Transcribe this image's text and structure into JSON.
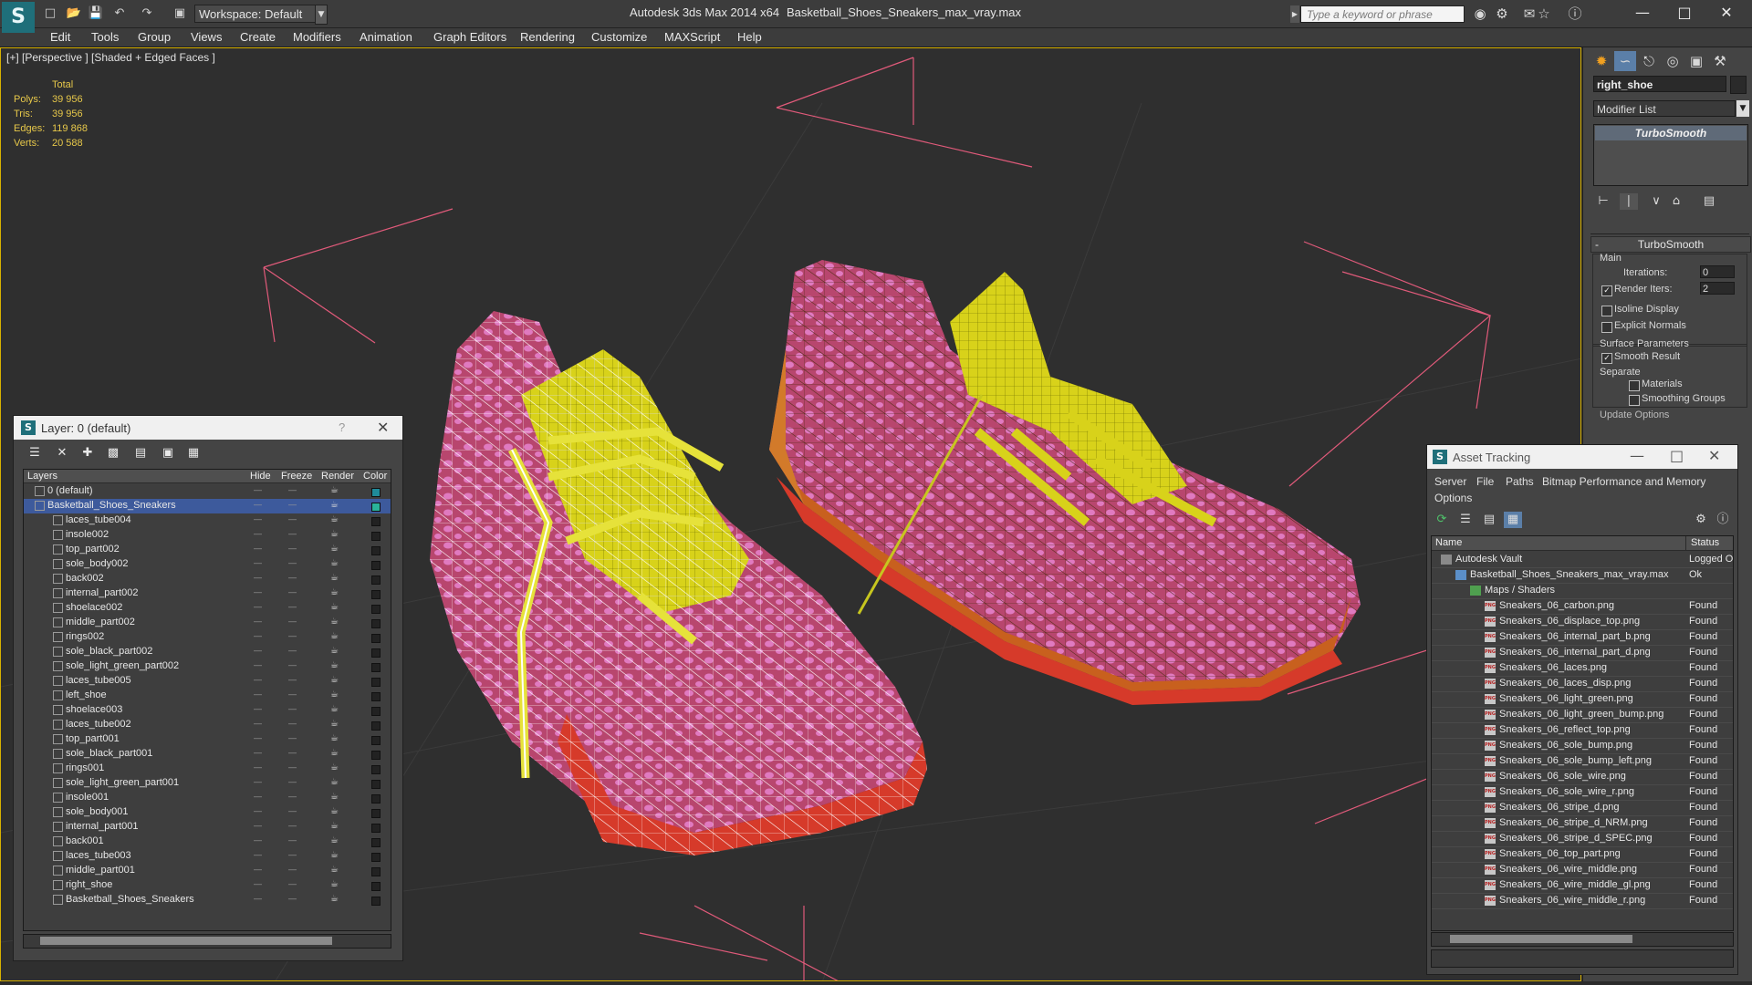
{
  "titlebar": {
    "workspace": "Workspace: Default",
    "app_title": "Autodesk 3ds Max  2014 x64",
    "file_title": "Basketball_Shoes_Sneakers_max_vray.max",
    "search_placeholder": "Type a keyword or phrase"
  },
  "menu": [
    "Edit",
    "Tools",
    "Group",
    "Views",
    "Create",
    "Modifiers",
    "Animation",
    "Graph Editors",
    "Rendering",
    "Customize",
    "MAXScript",
    "Help"
  ],
  "viewport": {
    "label": "[+] [Perspective ] [Shaded + Edged Faces ]",
    "stats": {
      "total_label": "Total",
      "rows": [
        {
          "k": "Polys:",
          "v": "39 956"
        },
        {
          "k": "Tris:",
          "v": "39 956"
        },
        {
          "k": "Edges:",
          "v": "119 868"
        },
        {
          "k": "Verts:",
          "v": "20 588"
        }
      ]
    }
  },
  "command_panel": {
    "object_name": "right_shoe",
    "modifier_list": "Modifier List",
    "stack_item": "TurboSmooth",
    "rollout_title": "TurboSmooth",
    "main_label": "Main",
    "iterations_label": "Iterations:",
    "iterations_value": "0",
    "render_iters_label": "Render Iters:",
    "render_iters_value": "2",
    "isoline": "Isoline Display",
    "explicit": "Explicit Normals",
    "surface_params": "Surface Parameters",
    "smooth_result": "Smooth Result",
    "separate": "Separate",
    "materials": "Materials",
    "smoothing_groups": "Smoothing Groups",
    "update_options": "Update Options"
  },
  "layer_panel": {
    "title": "Layer: 0 (default)",
    "help": "?",
    "headers": {
      "layers": "Layers",
      "hide": "Hide",
      "freeze": "Freeze",
      "render": "Render",
      "color": "Color"
    },
    "rows": [
      {
        "name": "0 (default)",
        "indent": 1,
        "color": "#1f8a9a",
        "selected": false
      },
      {
        "name": "Basketball_Shoes_Sneakers",
        "indent": 1,
        "color": "#2ab39a",
        "selected": true
      },
      {
        "name": "laces_tube004",
        "indent": 2
      },
      {
        "name": "insole002",
        "indent": 2
      },
      {
        "name": "top_part002",
        "indent": 2
      },
      {
        "name": "sole_body002",
        "indent": 2
      },
      {
        "name": "back002",
        "indent": 2
      },
      {
        "name": "internal_part002",
        "indent": 2
      },
      {
        "name": "shoelace002",
        "indent": 2
      },
      {
        "name": "middle_part002",
        "indent": 2
      },
      {
        "name": "rings002",
        "indent": 2
      },
      {
        "name": "sole_black_part002",
        "indent": 2
      },
      {
        "name": "sole_light_green_part002",
        "indent": 2
      },
      {
        "name": "laces_tube005",
        "indent": 2
      },
      {
        "name": "left_shoe",
        "indent": 2
      },
      {
        "name": "shoelace003",
        "indent": 2
      },
      {
        "name": "laces_tube002",
        "indent": 2
      },
      {
        "name": "top_part001",
        "indent": 2
      },
      {
        "name": "sole_black_part001",
        "indent": 2
      },
      {
        "name": "rings001",
        "indent": 2
      },
      {
        "name": "sole_light_green_part001",
        "indent": 2
      },
      {
        "name": "insole001",
        "indent": 2
      },
      {
        "name": "sole_body001",
        "indent": 2
      },
      {
        "name": "internal_part001",
        "indent": 2
      },
      {
        "name": "back001",
        "indent": 2
      },
      {
        "name": "laces_tube003",
        "indent": 2
      },
      {
        "name": "middle_part001",
        "indent": 2
      },
      {
        "name": "right_shoe",
        "indent": 2
      },
      {
        "name": "Basketball_Shoes_Sneakers",
        "indent": 2
      }
    ]
  },
  "asset_panel": {
    "title": "Asset Tracking",
    "menu": [
      "Server",
      "File",
      "Paths",
      "Bitmap Performance and Memory",
      "Options"
    ],
    "headers": {
      "name": "Name",
      "status": "Status"
    },
    "rows": [
      {
        "name": "Autodesk Vault",
        "status": "Logged O",
        "indent": 0,
        "icon": "vault"
      },
      {
        "name": "Basketball_Shoes_Sneakers_max_vray.max",
        "status": "Ok",
        "indent": 1,
        "icon": "file"
      },
      {
        "name": "Maps / Shaders",
        "status": "",
        "indent": 2,
        "icon": "folder"
      },
      {
        "name": "Sneakers_06_carbon.png",
        "status": "Found",
        "indent": 3,
        "icon": "png"
      },
      {
        "name": "Sneakers_06_displace_top.png",
        "status": "Found",
        "indent": 3,
        "icon": "png"
      },
      {
        "name": "Sneakers_06_internal_part_b.png",
        "status": "Found",
        "indent": 3,
        "icon": "png"
      },
      {
        "name": "Sneakers_06_internal_part_d.png",
        "status": "Found",
        "indent": 3,
        "icon": "png"
      },
      {
        "name": "Sneakers_06_laces.png",
        "status": "Found",
        "indent": 3,
        "icon": "png"
      },
      {
        "name": "Sneakers_06_laces_disp.png",
        "status": "Found",
        "indent": 3,
        "icon": "png"
      },
      {
        "name": "Sneakers_06_light_green.png",
        "status": "Found",
        "indent": 3,
        "icon": "png"
      },
      {
        "name": "Sneakers_06_light_green_bump.png",
        "status": "Found",
        "indent": 3,
        "icon": "png"
      },
      {
        "name": "Sneakers_06_reflect_top.png",
        "status": "Found",
        "indent": 3,
        "icon": "png"
      },
      {
        "name": "Sneakers_06_sole_bump.png",
        "status": "Found",
        "indent": 3,
        "icon": "png"
      },
      {
        "name": "Sneakers_06_sole_bump_left.png",
        "status": "Found",
        "indent": 3,
        "icon": "png"
      },
      {
        "name": "Sneakers_06_sole_wire.png",
        "status": "Found",
        "indent": 3,
        "icon": "png"
      },
      {
        "name": "Sneakers_06_sole_wire_r.png",
        "status": "Found",
        "indent": 3,
        "icon": "png"
      },
      {
        "name": "Sneakers_06_stripe_d.png",
        "status": "Found",
        "indent": 3,
        "icon": "png"
      },
      {
        "name": "Sneakers_06_stripe_d_NRM.png",
        "status": "Found",
        "indent": 3,
        "icon": "png"
      },
      {
        "name": "Sneakers_06_stripe_d_SPEC.png",
        "status": "Found",
        "indent": 3,
        "icon": "png"
      },
      {
        "name": "Sneakers_06_top_part.png",
        "status": "Found",
        "indent": 3,
        "icon": "png"
      },
      {
        "name": "Sneakers_06_wire_middle.png",
        "status": "Found",
        "indent": 3,
        "icon": "png"
      },
      {
        "name": "Sneakers_06_wire_middle_gl.png",
        "status": "Found",
        "indent": 3,
        "icon": "png"
      },
      {
        "name": "Sneakers_06_wire_middle_r.png",
        "status": "Found",
        "indent": 3,
        "icon": "png"
      }
    ]
  },
  "colors": {
    "accent": "#d8b100",
    "selection": "#3d5a9c",
    "shoe_body": "#c8507a",
    "shoe_spots": "#e57ac4",
    "tongue": "#d8d21a",
    "sole": "#c83a2a",
    "gizmo": "#e05a7a"
  }
}
